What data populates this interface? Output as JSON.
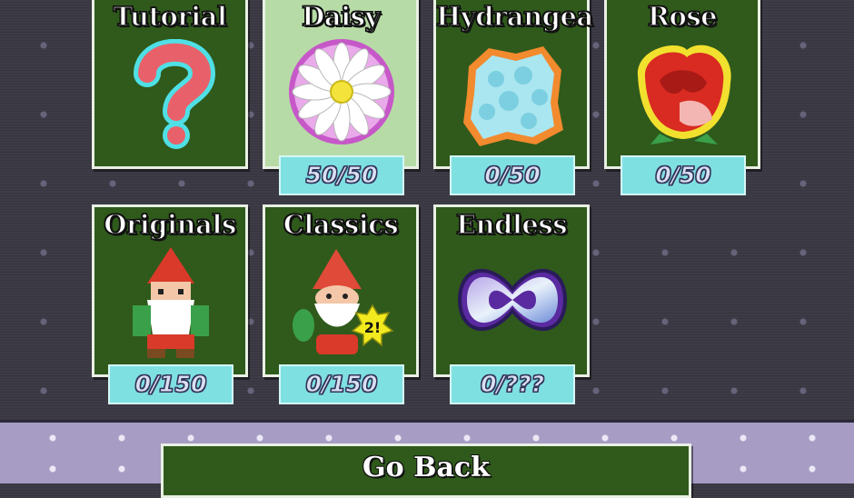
{
  "packs": [
    {
      "title": "Tutorial",
      "icon": "question-mark-icon",
      "progress": ""
    },
    {
      "title": "Daisy",
      "icon": "daisy-icon",
      "progress": "50/50",
      "selected": true
    },
    {
      "title": "Hydrangea",
      "icon": "hydrangea-icon",
      "progress": "0/50"
    },
    {
      "title": "Rose",
      "icon": "rose-icon",
      "progress": "0/50"
    },
    {
      "title": "Originals",
      "icon": "gnome-icon",
      "progress": "0/150"
    },
    {
      "title": "Classics",
      "icon": "gnome-sequel-icon",
      "progress": "0/150",
      "badge": "2!"
    },
    {
      "title": "Endless",
      "icon": "infinity-icon",
      "progress": "0/???"
    }
  ],
  "go_back_label": "Go Back",
  "colors": {
    "card_bg": "#2f5a1b",
    "card_selected_bg": "#b7dba6",
    "progress_bg": "#7fe0e2",
    "page_bg": "#3d3b46",
    "bottom_strip": "#a69cc4"
  }
}
